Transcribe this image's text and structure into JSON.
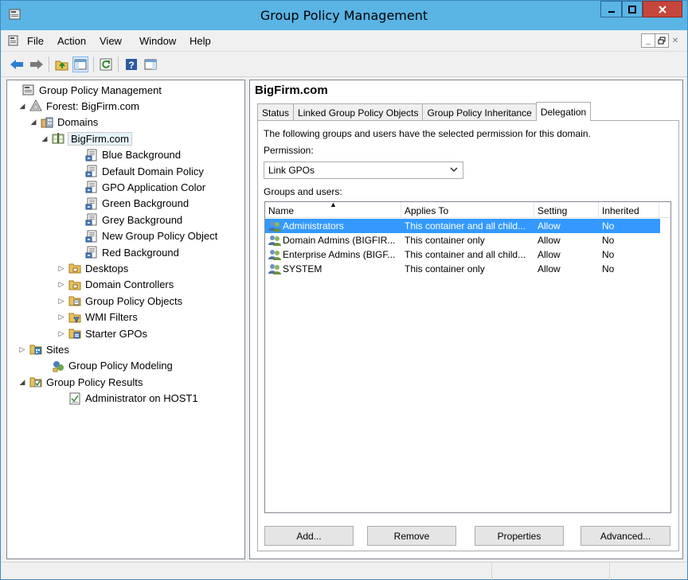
{
  "window": {
    "title": "Group Policy Management",
    "minimize_label": "‒",
    "maximize_label": "□",
    "close_label": "✕"
  },
  "menu": {
    "items": [
      "File",
      "Action",
      "View",
      "Window",
      "Help"
    ]
  },
  "mdi": {
    "minimize": "_",
    "restore": "🗗",
    "close": "✕"
  },
  "tree": {
    "nodes": [
      {
        "label": "Group Policy Management",
        "icon": "gpm-console-icon",
        "expander": ""
      },
      {
        "label": "Forest: BigFirm.com",
        "icon": "forest-icon",
        "expander": "◢"
      },
      {
        "label": "Domains",
        "icon": "domains-icon",
        "expander": "◢"
      },
      {
        "label": "BigFirm.com",
        "icon": "domain-icon",
        "expander": "◢"
      },
      {
        "label": "Blue Background",
        "icon": "gpo-link-icon",
        "expander": ""
      },
      {
        "label": "Default Domain Policy",
        "icon": "gpo-link-icon",
        "expander": ""
      },
      {
        "label": "GPO Application Color",
        "icon": "gpo-link-icon",
        "expander": ""
      },
      {
        "label": "Green Background",
        "icon": "gpo-link-icon",
        "expander": ""
      },
      {
        "label": "Grey Background",
        "icon": "gpo-link-icon",
        "expander": ""
      },
      {
        "label": "New Group Policy Object",
        "icon": "gpo-link-icon",
        "expander": ""
      },
      {
        "label": "Red Background",
        "icon": "gpo-link-icon",
        "expander": ""
      },
      {
        "label": "Desktops",
        "icon": "ou-folder-icon",
        "expander": "▷"
      },
      {
        "label": "Domain Controllers",
        "icon": "ou-folder-icon",
        "expander": "▷"
      },
      {
        "label": "Group Policy Objects",
        "icon": "gpo-folder-icon",
        "expander": "▷"
      },
      {
        "label": "WMI Filters",
        "icon": "wmi-folder-icon",
        "expander": "▷"
      },
      {
        "label": "Starter GPOs",
        "icon": "starter-folder-icon",
        "expander": "▷"
      },
      {
        "label": "Sites",
        "icon": "sites-icon",
        "expander": "▷"
      },
      {
        "label": "Group Policy Modeling",
        "icon": "modeling-icon",
        "expander": ""
      },
      {
        "label": "Group Policy Results",
        "icon": "results-folder-icon",
        "expander": "◢"
      },
      {
        "label": "Administrator on HOST1",
        "icon": "report-icon",
        "expander": ""
      }
    ]
  },
  "main": {
    "title": "BigFirm.com",
    "tabs": [
      "Status",
      "Linked Group Policy Objects",
      "Group Policy Inheritance",
      "Delegation"
    ],
    "active_tab": "Delegation",
    "description": "The following groups and users have the selected permission for this domain.",
    "permission_label": "Permission:",
    "permission_value": "Link GPOs",
    "groups_label": "Groups and users:",
    "columns": [
      "Name",
      "Applies To",
      "Setting",
      "Inherited"
    ],
    "rows": [
      {
        "name": "Administrators",
        "applies_to": "This container and all child...",
        "setting": "Allow",
        "inherited": "No"
      },
      {
        "name": "Domain Admins (BIGFIR...",
        "applies_to": "This container only",
        "setting": "Allow",
        "inherited": "No"
      },
      {
        "name": "Enterprise Admins (BIGF...",
        "applies_to": "This container and all child...",
        "setting": "Allow",
        "inherited": "No"
      },
      {
        "name": "SYSTEM",
        "applies_to": "This container only",
        "setting": "Allow",
        "inherited": "No"
      }
    ],
    "buttons": {
      "add": "Add...",
      "remove": "Remove",
      "properties": "Properties",
      "advanced": "Advanced..."
    }
  },
  "colors": {
    "titlebar": "#5ab4e4",
    "selection": "#3399ff",
    "close": "#c7463c"
  }
}
